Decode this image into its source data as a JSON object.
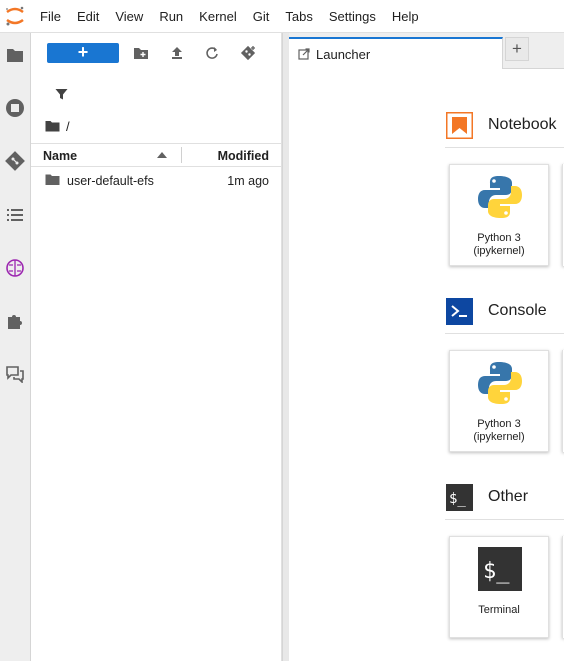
{
  "menubar": {
    "items": [
      "File",
      "Edit",
      "View",
      "Run",
      "Kernel",
      "Git",
      "Tabs",
      "Settings",
      "Help"
    ]
  },
  "activitybar": {
    "icons": [
      "folder-icon",
      "running-icon",
      "git-icon",
      "toc-icon",
      "brain-icon",
      "extension-icon",
      "chat-icon"
    ]
  },
  "filebrowser": {
    "new_button_label": "+",
    "breadcrumb": "/",
    "columns": {
      "name": "Name",
      "modified": "Modified"
    },
    "files": [
      {
        "name": "user-default-efs",
        "modified": "1m ago",
        "type": "folder"
      }
    ]
  },
  "tabs": {
    "active_label": "Launcher",
    "add_label": "+"
  },
  "launcher": {
    "sections": [
      {
        "title": "Notebook",
        "cards": [
          {
            "label_line1": "Python 3",
            "label_line2": "(ipykernel)"
          }
        ]
      },
      {
        "title": "Console",
        "cards": [
          {
            "label_line1": "Python 3",
            "label_line2": "(ipykernel)"
          }
        ]
      },
      {
        "title": "Other",
        "cards": [
          {
            "label_line1": "Terminal",
            "label_line2": ""
          }
        ]
      }
    ]
  },
  "colors": {
    "accent": "#1976d2",
    "notebook_orange": "#f37726",
    "console_blue": "#0d47a1",
    "other_dark": "#333333",
    "ai_purple": "#9c27b0"
  }
}
